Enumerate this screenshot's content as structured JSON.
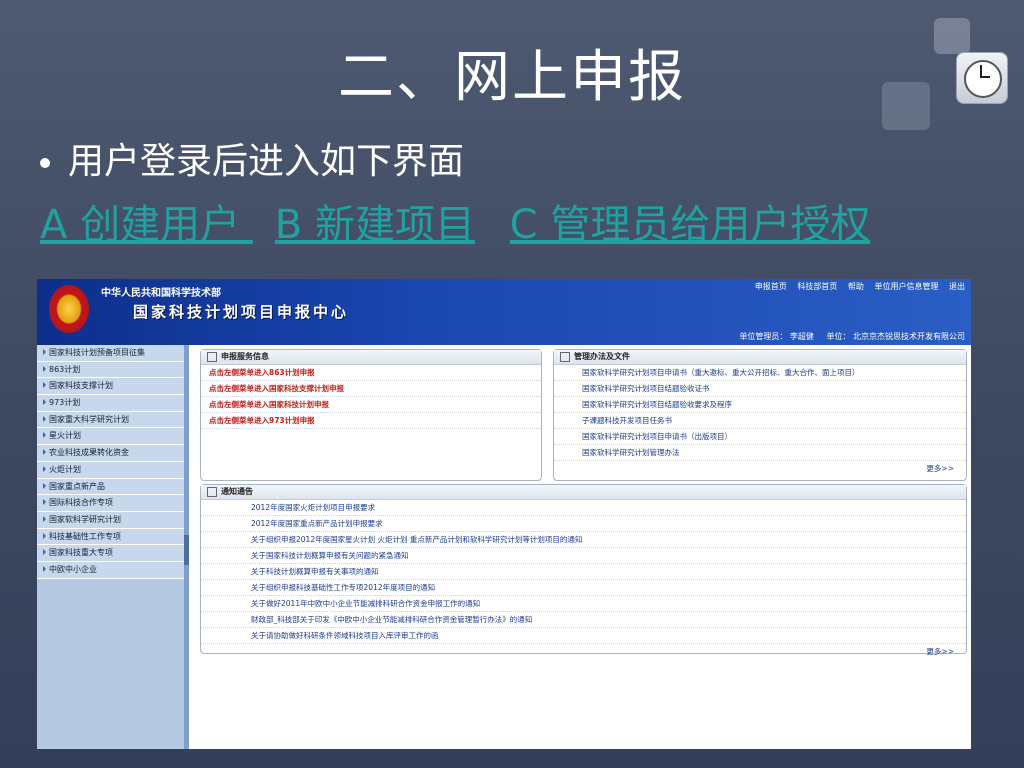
{
  "slide": {
    "title": "二、网上申报",
    "bullet": "用户登录后进入如下界面",
    "links": [
      "A 创建用户 ",
      "B 新建项目",
      "C 管理员给用户授权"
    ]
  },
  "screenshot": {
    "ministry": "中华人民共和国科学技术部",
    "center": "国家科技计划项目申报中心",
    "topnav": [
      "申报首页",
      "科技部首页",
      "帮助",
      "单位用户信息管理",
      "退出"
    ],
    "unit_admin": "单位管理员： 李超健",
    "unit_name": "单位： 北京京杰锐思技术开发有限公司",
    "sidebar": [
      "国家科技计划预备项目征集",
      "863计划",
      "国家科技支撑计划",
      "973计划",
      "国家重大科学研究计划",
      "星火计划",
      "农业科技成果转化资金",
      "火炬计划",
      "国家重点新产品",
      "国际科技合作专项",
      "国家软科学研究计划",
      "科技基础性工作专项",
      "国家科技重大专项",
      "中欧中小企业"
    ],
    "service": {
      "title": "申报服务信息",
      "items": [
        "点击左侧菜单进入863计划申报",
        "点击左侧菜单进入国家科技支撑计划申报",
        "点击左侧菜单进入国家科技计划申报",
        "点击左侧菜单进入973计划申报"
      ]
    },
    "docs": {
      "title": "管理办法及文件",
      "items": [
        "国家软科学研究计划项目申请书（重大邀标、重大公开招标、重大合作、面上项目）",
        "国家软科学研究计划项目结题验收证书",
        "国家软科学研究计划项目结题验收要求及程序",
        "子课题科技开发项目任务书",
        "国家软科学研究计划项目申请书（出版项目）",
        "国家软科学研究计划管理办法"
      ],
      "more": "更多>>"
    },
    "notice": {
      "title": "通知通告",
      "items": [
        "2012年度国家火炬计划项目申报要求",
        "2012年度国家重点新产品计划申报要求",
        "关于组织申报2012年度国家星火计划 火炬计划 重点新产品计划和软科学研究计划等计划项目的通知",
        "关于国家科技计划概算申报有关问题的紧急通知",
        "关于科技计划概算申报有关事项的通知",
        "关于组织申报科技基础性工作专项2012年度项目的通知",
        "关于做好2011年中欧中小企业节能减排科研合作资金申报工作的通知",
        "财政部_科技部关于印发《中欧中小企业节能减排科研合作资金管理暂行办法》的通知",
        "关于请协助做好科研条件领域科技项目入库评审工作的函"
      ],
      "more": "更多>>"
    }
  }
}
